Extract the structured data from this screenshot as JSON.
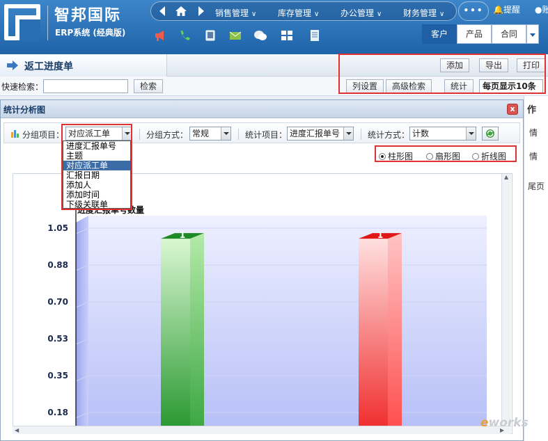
{
  "header": {
    "brand": "智邦国际",
    "brand_sub": "ERP系统 (经典版)",
    "nav": [
      "销售管理",
      "库存管理",
      "办公管理",
      "财务管理"
    ],
    "more": "•••",
    "remind": "提醒",
    "user_trunc": "账",
    "tool_icons": [
      "megaphone-icon",
      "phone-icon",
      "mobile-icon",
      "mail-icon",
      "wechat-icon",
      "grid-icon",
      "document-icon"
    ],
    "customer_tabs": [
      "客户",
      "产品",
      "合同"
    ]
  },
  "page": {
    "title": "返工进度单",
    "buttons": {
      "add": "添加",
      "export": "导出",
      "print": "打印",
      "columns": "列设置",
      "advanced": "高级检索",
      "stats": "统计"
    },
    "page_size": "每页显示10条",
    "search_label": "快速检索：",
    "search_button": "检索"
  },
  "background": {
    "col_header": "作",
    "row1": "情",
    "row2": "情",
    "last_page": "尾页"
  },
  "dialog": {
    "title": "统计分析图",
    "close": "x",
    "group_item_label": "分组项目：",
    "group_item_value": "对应派工单",
    "group_method_label": "分组方式：",
    "group_method_value": "常规",
    "stat_item_label": "统计项目：",
    "stat_item_value": "进度汇报单号",
    "stat_method_label": "统计方式：",
    "stat_method_value": "计数",
    "dropdown_options": [
      "进度汇报单号",
      "主题",
      "对应派工单",
      "汇报日期",
      "添加人",
      "添加时间",
      "下级关联单"
    ],
    "dropdown_selected_index": 2,
    "chart_types": [
      "柱形图",
      "扇形图",
      "折线图"
    ],
    "chart_type_selected": "柱形图"
  },
  "chart_data": {
    "type": "bar",
    "ylabel": "进度汇报单号数量",
    "y_ticks": [
      "1.05",
      "0.88",
      "0.70",
      "0.53",
      "0.35",
      "0.18"
    ],
    "ylim": [
      0,
      1.05
    ],
    "series": [
      {
        "value": 1,
        "label": "1",
        "color": "#2fa23a"
      },
      {
        "value": 1,
        "label": "1",
        "color": "#e83030"
      }
    ]
  },
  "watermark": {
    "pre": "e",
    "rest": "works"
  }
}
